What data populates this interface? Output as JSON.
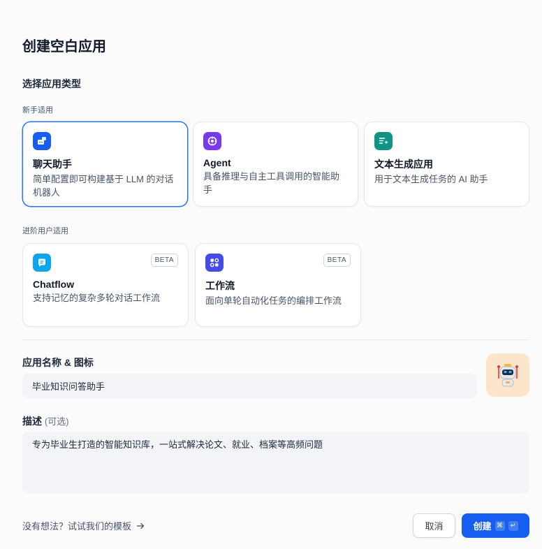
{
  "dialog": {
    "title": "创建空白应用"
  },
  "app_type": {
    "section_title": "选择应用类型",
    "beginner_label": "新手适用",
    "advanced_label": "进阶用户适用",
    "cards": [
      {
        "title": "聊天助手",
        "desc": "简单配置即可构建基于 LLM 的对话机器人",
        "icon": "chat-bot-icon",
        "color": "#155eef"
      },
      {
        "title": "Agent",
        "desc": "具备推理与自主工具调用的智能助手",
        "icon": "agent-icon",
        "color": "#7839ee"
      },
      {
        "title": "文本生成应用",
        "desc": "用于文本生成任务的 AI 助手",
        "icon": "text-generation-icon",
        "color": "#0e9384"
      },
      {
        "title": "Chatflow",
        "desc": "支持记忆的复杂多轮对话工作流",
        "icon": "chatflow-icon",
        "color": "#0ba5ec",
        "badge": "BETA"
      },
      {
        "title": "工作流",
        "desc": "面向单轮自动化任务的编排工作流",
        "icon": "workflow-icon",
        "color": "#444ce7",
        "badge": "BETA"
      }
    ]
  },
  "name_field": {
    "label": "应用名称 & 图标",
    "value": "毕业知识问答助手"
  },
  "desc_field": {
    "label": "描述",
    "optional": "(可选)",
    "value": "专为毕业生打造的智能知识库，一站式解决论文、就业、档案等高频问题"
  },
  "footer": {
    "template_link": "没有想法？试试我们的模板",
    "cancel_label": "取消",
    "create_label": "创建",
    "create_shortcut_cmd": "⌘",
    "create_shortcut_enter": "↵"
  }
}
